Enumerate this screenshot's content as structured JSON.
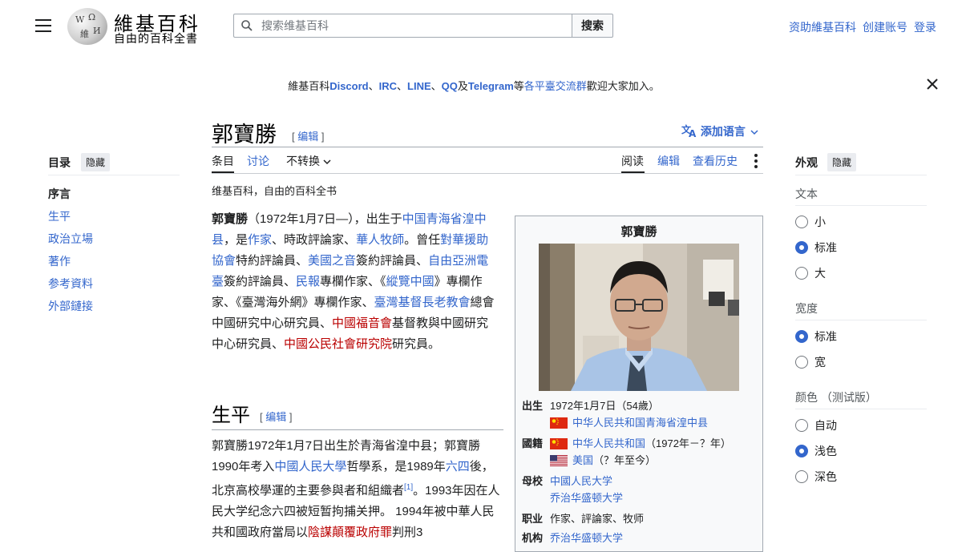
{
  "header": {
    "menu_icon": "hamburger-menu-icon",
    "logo_title": "維基百科",
    "logo_subtitle": "自由的百科全書",
    "search_placeholder": "搜索维基百科",
    "search_button": "搜索",
    "user_links": [
      "资助維基百科",
      "创建账号",
      "登录"
    ]
  },
  "sitenotice": {
    "prefix": "維基百科",
    "discord": "Discord",
    "sep1": "、",
    "irc": "IRC",
    "sep2": "、",
    "line": "LINE",
    "sep3": "、",
    "qq": "QQ",
    "and": "及",
    "telegram": "Telegram",
    "mid": "等",
    "groups_link": "各平臺交流群",
    "suffix": "歡迎大家加入。",
    "close_icon": "close-icon"
  },
  "page": {
    "title": "郭寶勝",
    "edit_label": "编辑",
    "add_languages": "添加语言",
    "tagline": "维基百科，自由的百科全书"
  },
  "tabs": {
    "article": "条目",
    "talk": "讨论",
    "variant": "不转换",
    "read": "阅读",
    "edit": "编辑",
    "history": "查看历史"
  },
  "toc": {
    "heading": "目录",
    "hide": "隐藏",
    "items": [
      "序言",
      "生平",
      "政治立場",
      "著作",
      "参考資料",
      "外部鏈接"
    ]
  },
  "appearance": {
    "heading": "外观",
    "hide": "隐藏",
    "text_label": "文本",
    "text_options": [
      "小",
      "标准",
      "大"
    ],
    "text_selected": "标准",
    "width_label": "宽度",
    "width_options": [
      "标准",
      "宽"
    ],
    "width_selected": "标准",
    "color_label": "颜色 （测试版）",
    "color_options": [
      "自动",
      "浅色",
      "深色"
    ],
    "color_selected": "浅色"
  },
  "lead": {
    "name": "郭寶勝",
    "t1": "（1972年1月7日—），出生于",
    "l_birthplace": "中国青海省湟中县",
    "t2": "，是",
    "l_writer": "作家",
    "t3": "、時政評論家、",
    "l_pastor": "華人牧師",
    "t4": "。曾任",
    "l_chinaaid": "對華援助協會",
    "t5": "特約評論員、",
    "l_voa": "美國之音",
    "t6": "簽約評論員、",
    "l_rfa": "自由亞洲電臺",
    "t7": "簽約評論員、",
    "l_minbao": "民報",
    "t8": "專欄作家、《",
    "l_zonglan": "縱覽中國",
    "t9": "》專欄作家、《臺灣海外網》專欄作家、",
    "l_elders": "臺灣基督長老教會",
    "t10": "總會中國研究中心研究員、",
    "l_gospel": "中國福音會",
    "t11": "基督教與中國研究中心研究員、",
    "l_civil": "中國公民社會研究院",
    "t12": "研究員。"
  },
  "section_life": {
    "heading": "生平",
    "edit_label": "编辑",
    "t1": "郭寶勝1972年1月7日出生於青海省湟中县；郭寶勝1990年考入",
    "l_ruc": "中國人民大學",
    "t2": "哲學系，是1989年",
    "l_64": "六四",
    "t3": "後，北京高校學運的主要參與者和組織者",
    "ref": "[1]",
    "t4": "。1993年因在人民大学纪念六四被短暂拘捕关押。 1994年被中華人民共和國政府當局以",
    "l_crime": "陰謀顛覆政府罪",
    "t5": "判刑3"
  },
  "infobox": {
    "title": "郭寶勝",
    "born_label": "出生",
    "born_date": "1972年1月7日（54歲）",
    "born_place": "中华人民共和国青海省湟中县",
    "nationality_label": "國籍",
    "nat1": "中华人民共和国",
    "nat1_years": "（1972年－？年）",
    "nat2": "美国",
    "nat2_years": "（？年至今）",
    "alma_label": "母校",
    "alma1": "中國人民大学",
    "alma2": "乔治华盛顿大学",
    "occ_label": "职业",
    "occupation": "作家、評論家、牧师",
    "inst_label": "机构",
    "institution": "乔治华盛顿大学",
    "flags": {
      "prc": "#de2910",
      "prc_star": "#ffde00",
      "us_red": "#b22234",
      "us_blue": "#3c3b6e"
    }
  }
}
